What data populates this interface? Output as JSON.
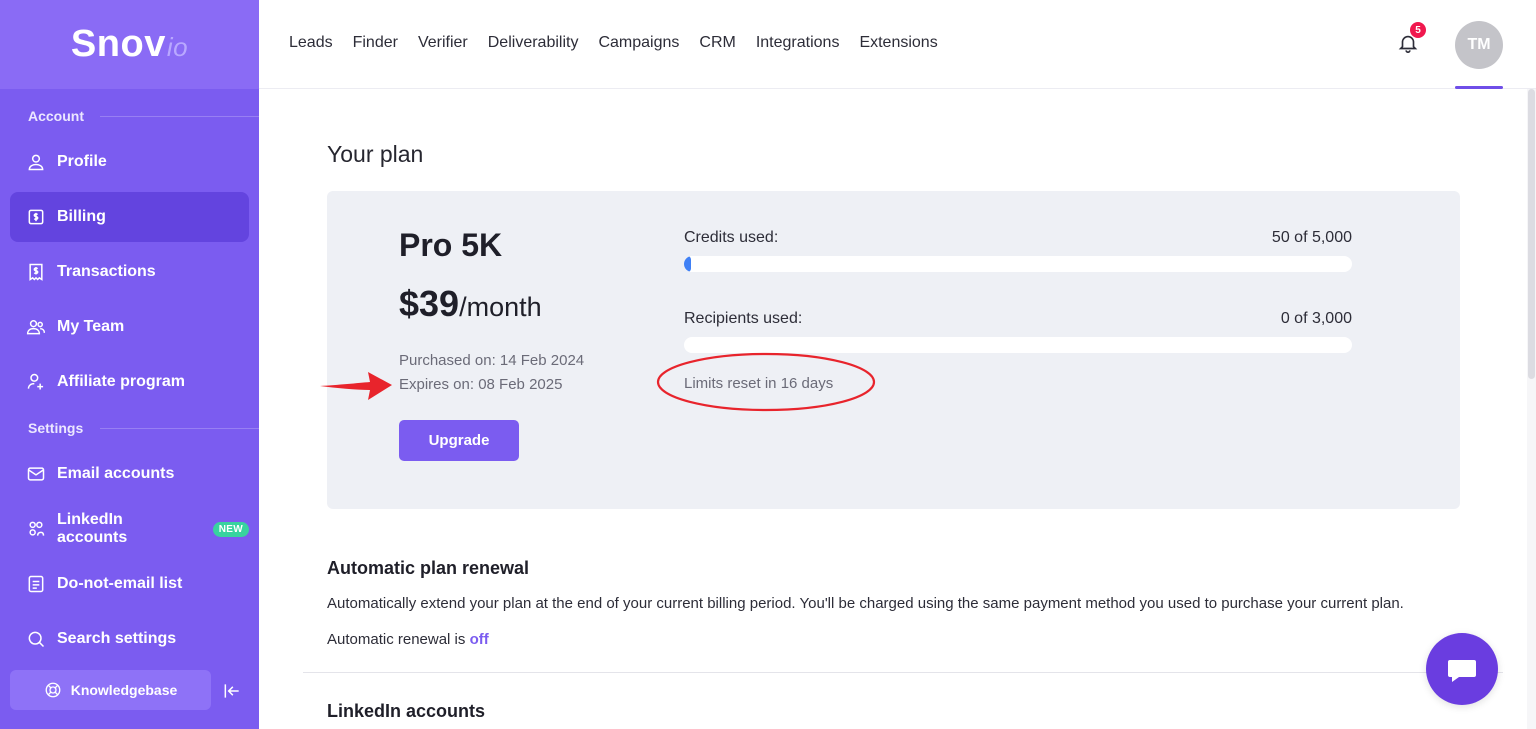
{
  "brand": {
    "name": "Snov",
    "suffix": "io"
  },
  "topnav": [
    "Leads",
    "Finder",
    "Verifier",
    "Deliverability",
    "Campaigns",
    "CRM",
    "Integrations",
    "Extensions"
  ],
  "notifications": {
    "count": "5"
  },
  "user": {
    "initials": "TM"
  },
  "sidebar": {
    "account_label": "Account",
    "settings_label": "Settings",
    "account_items": [
      {
        "label": "Profile",
        "icon": "user-icon"
      },
      {
        "label": "Billing",
        "icon": "dollar-square-icon",
        "active": true
      },
      {
        "label": "Transactions",
        "icon": "receipt-icon"
      },
      {
        "label": "My Team",
        "icon": "team-icon"
      },
      {
        "label": "Affiliate program",
        "icon": "user-plus-icon"
      }
    ],
    "settings_items": [
      {
        "label": "Email accounts",
        "icon": "mail-icon"
      },
      {
        "label": "LinkedIn accounts",
        "icon": "people-icon",
        "badge": "NEW"
      },
      {
        "label": "Do-not-email list",
        "icon": "list-doc-icon"
      },
      {
        "label": "Search settings",
        "icon": "search-icon"
      }
    ],
    "knowledgebase_label": "Knowledgebase"
  },
  "plan": {
    "page_title": "Your plan",
    "name": "Pro 5K",
    "price": "$39",
    "period": "/month",
    "purchased": "Purchased on: 14 Feb 2024",
    "expires": "Expires on: 08 Feb 2025",
    "upgrade_label": "Upgrade",
    "credits_label": "Credits used:",
    "credits_value": "50 of 5,000",
    "credits_used": 50,
    "credits_total": 5000,
    "recipients_label": "Recipients used:",
    "recipients_value": "0 of 3,000",
    "recipients_used": 0,
    "recipients_total": 3000,
    "reset_text": "Limits reset in 16 days"
  },
  "renewal": {
    "title": "Automatic plan renewal",
    "description": "Automatically extend your plan at the end of your current billing period. You'll be charged using the same payment method you used to purchase your current plan.",
    "status_prefix": "Automatic renewal is ",
    "status": "off"
  },
  "linkedin_section": {
    "title": "LinkedIn accounts"
  },
  "colors": {
    "accent": "#7b5cf0",
    "sidebar": "#7b5cf0",
    "progress": "#3f80f5",
    "annotation": "#e8242c",
    "badge": "#f0184e"
  }
}
